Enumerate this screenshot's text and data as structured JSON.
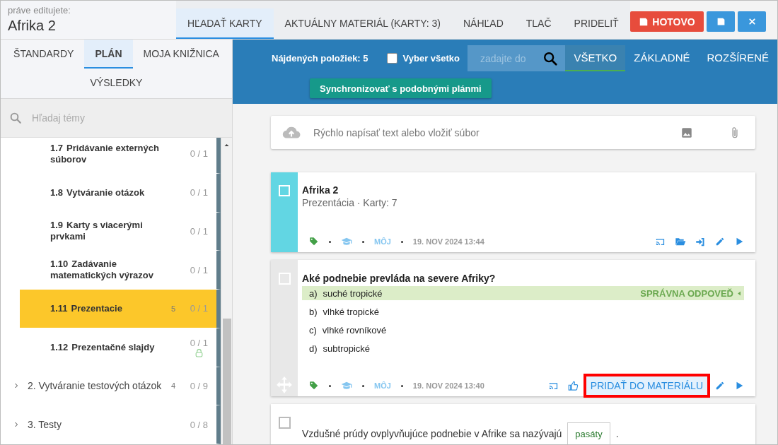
{
  "header": {
    "caption": "práve editujete:",
    "title": "Afrika 2"
  },
  "tabs": [
    {
      "label": "HĽADAŤ KARTY",
      "selected": true
    },
    {
      "label": "AKTUÁLNY MATERIÁL (KARTY: 3)",
      "selected": false
    },
    {
      "label": "NÁHĽAD",
      "selected": false
    },
    {
      "label": "TLAČ",
      "selected": false
    },
    {
      "label": "PRIDELIŤ",
      "selected": false
    }
  ],
  "actions": [
    {
      "kind": "done",
      "label": "HOTOVO"
    },
    {
      "kind": "save"
    },
    {
      "kind": "close"
    }
  ],
  "sidebar": {
    "tabs": [
      {
        "label": "ŠTANDARDY",
        "selected": false
      },
      {
        "label": "PLÁN",
        "selected": true
      },
      {
        "label": "MOJA KNIŽNICA",
        "selected": false
      },
      {
        "label": "VÝSLEDKY",
        "selected": false
      }
    ],
    "search": {
      "placeholder": "Hľadaj témy"
    },
    "tree": [
      {
        "children": [
          {
            "number": "1.7",
            "title": "Pridávanie externých súborov",
            "progress": "0 / 1",
            "selected": false,
            "locked": false
          },
          {
            "number": "1.8",
            "title": "Vytváranie otázok",
            "progress": "0 / 1",
            "selected": false,
            "locked": false
          },
          {
            "number": "1.9",
            "title": "Karty s viacerými prvkami",
            "progress": "0 / 1",
            "selected": false,
            "locked": false
          },
          {
            "number": "1.10",
            "title": "Zadávanie matematických výrazov",
            "progress": "0 / 1",
            "selected": false,
            "locked": false
          },
          {
            "number": "1.11",
            "title": "Prezentacie",
            "count": "5",
            "progress": "0 / 1",
            "selected": true,
            "locked": false
          },
          {
            "number": "1.12",
            "title": "Prezentačné slajdy",
            "progress": "0 / 1",
            "selected": false,
            "locked": true
          }
        ]
      },
      {
        "label": "2. Vytváranie testových otázok",
        "count": "4",
        "progress": "0 / 9",
        "expanded": false
      },
      {
        "label": "3. Testy",
        "progress": "0 / 8",
        "expanded": false
      }
    ]
  },
  "toolbar": {
    "found": "Nájdených položiek: 5",
    "select_all": {
      "label": "Vyber všetko",
      "checked": false
    },
    "search": {
      "placeholder": "zadajte do"
    },
    "filters": [
      {
        "label": "VŠETKO",
        "selected": true
      },
      {
        "label": "ZÁKLADNÉ",
        "selected": false
      },
      {
        "label": "ROZŠÍRENÉ",
        "selected": false
      }
    ],
    "sync_button": "Synchronizovať s podobnými plánmi"
  },
  "quick_entry": {
    "placeholder": "Rýchlo napísať text alebo vložiť súbor"
  },
  "cards": [
    {
      "kind": "presentation",
      "checked": false,
      "title": "Afrika 2",
      "subtitle": "Prezentácia · Karty: 7",
      "owner": "MÔJ",
      "date": "19. NOV 2024 13:44"
    },
    {
      "kind": "question",
      "checked": false,
      "question": "Aké podnebie prevláda na severe Afriky?",
      "answers": [
        {
          "letter": "a)",
          "text": "suché tropické",
          "correct": true
        },
        {
          "letter": "b)",
          "text": "vlhké tropické",
          "correct": false
        },
        {
          "letter": "c)",
          "text": "vlhké rovníkové",
          "correct": false
        },
        {
          "letter": "d)",
          "text": "subtropické",
          "correct": false
        }
      ],
      "correct_label": "SPRÁVNA ODPOVEĎ",
      "owner": "MÔJ",
      "date": "19. NOV 2024 13:40",
      "add_button": {
        "label": "PRIDAŤ DO MATERIÁLU",
        "highlighted": true
      }
    },
    {
      "kind": "fill_in",
      "checked": false,
      "text_before": "Vzdušné prúdy ovplyvňujúce podnebie v Afrike sa nazývajú",
      "answer": "pasáty",
      "text_after": "."
    }
  ]
}
